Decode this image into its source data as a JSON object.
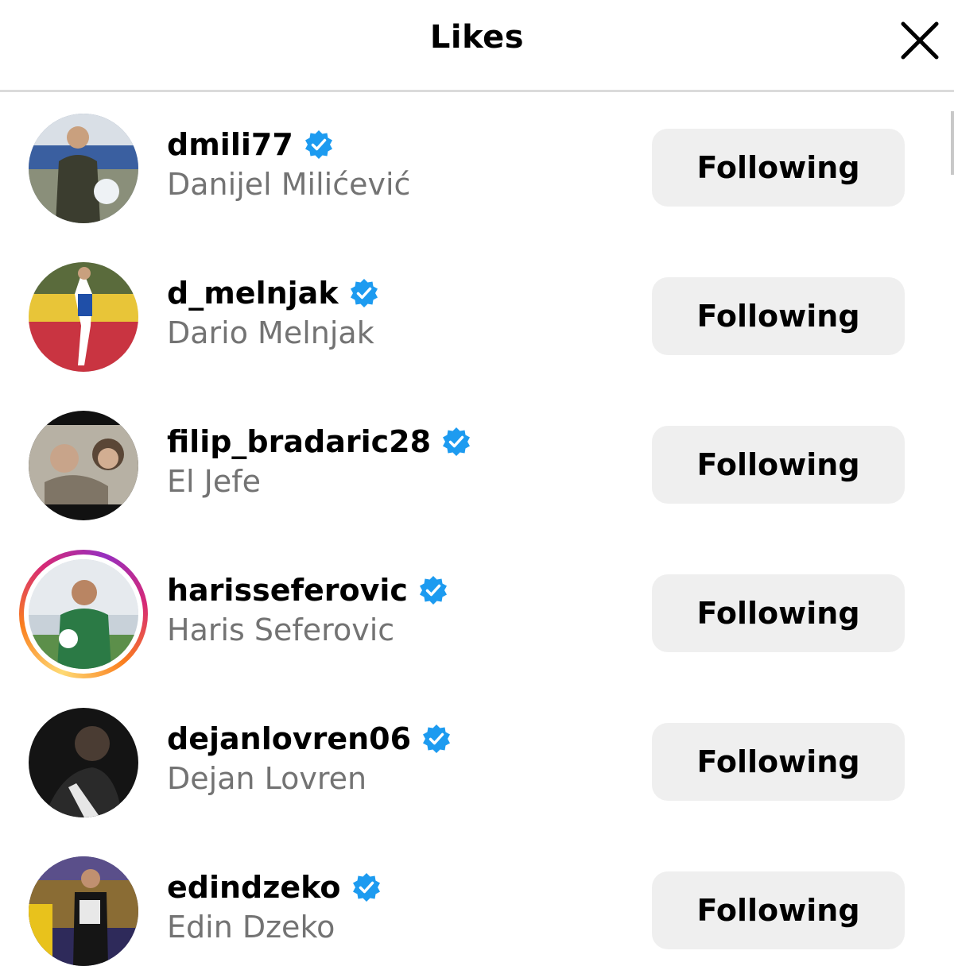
{
  "modal": {
    "title": "Likes",
    "close_icon": "close-icon"
  },
  "colors": {
    "verified": "#1d9bf0",
    "button_bg": "#efefef",
    "secondary_text": "#737373",
    "divider": "#dbdbdb"
  },
  "likes": [
    {
      "username": "dmili77",
      "full_name": "Danijel Milićević",
      "verified": true,
      "button_label": "Following",
      "has_story": false
    },
    {
      "username": "d_melnjak",
      "full_name": "Dario Melnjak",
      "verified": true,
      "button_label": "Following",
      "has_story": false
    },
    {
      "username": "filip_bradaric28",
      "full_name": "El Jefe",
      "verified": true,
      "button_label": "Following",
      "has_story": false
    },
    {
      "username": "harisseferovic",
      "full_name": "Haris Seferovic",
      "verified": true,
      "button_label": "Following",
      "has_story": true
    },
    {
      "username": "dejanlovren06",
      "full_name": "Dejan Lovren",
      "verified": true,
      "button_label": "Following",
      "has_story": false
    },
    {
      "username": "edindzeko",
      "full_name": "Edin Dzeko",
      "verified": true,
      "button_label": "Following",
      "has_story": false
    }
  ]
}
